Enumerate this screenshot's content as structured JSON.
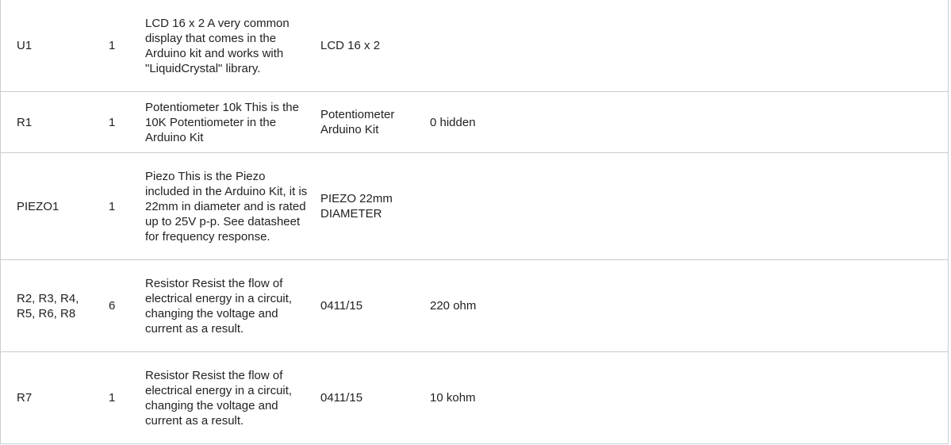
{
  "bom": {
    "rows": [
      {
        "designator": "U1",
        "quantity": "1",
        "description": "LCD 16 x 2 A very common display that comes in the Arduino kit and works with \"LiquidCrystal\" library.",
        "part": "LCD 16 x 2",
        "value": ""
      },
      {
        "designator": "R1",
        "quantity": "1",
        "description": "Potentiometer 10k This is the 10K Potentiometer in the Arduino Kit",
        "part": "Potentiometer Arduino Kit",
        "value": "0 hidden"
      },
      {
        "designator": "PIEZO1",
        "quantity": "1",
        "description": "Piezo This is the Piezo included in the Arduino Kit, it is 22mm in diameter and is rated up to 25V p-p. See datasheet for frequency response.",
        "part": "PIEZO 22mm DIAMETER",
        "value": ""
      },
      {
        "designator": "R2, R3, R4, R5, R6, R8",
        "quantity": "6",
        "description": "Resistor Resist the flow of electrical energy in a circuit, changing the voltage and current as a result.",
        "part": "0411/15",
        "value": "220 ohm"
      },
      {
        "designator": "R7",
        "quantity": "1",
        "description": "Resistor Resist the flow of electrical energy in a circuit, changing the voltage and current as a result.",
        "part": "0411/15",
        "value": "10 kohm"
      }
    ]
  }
}
